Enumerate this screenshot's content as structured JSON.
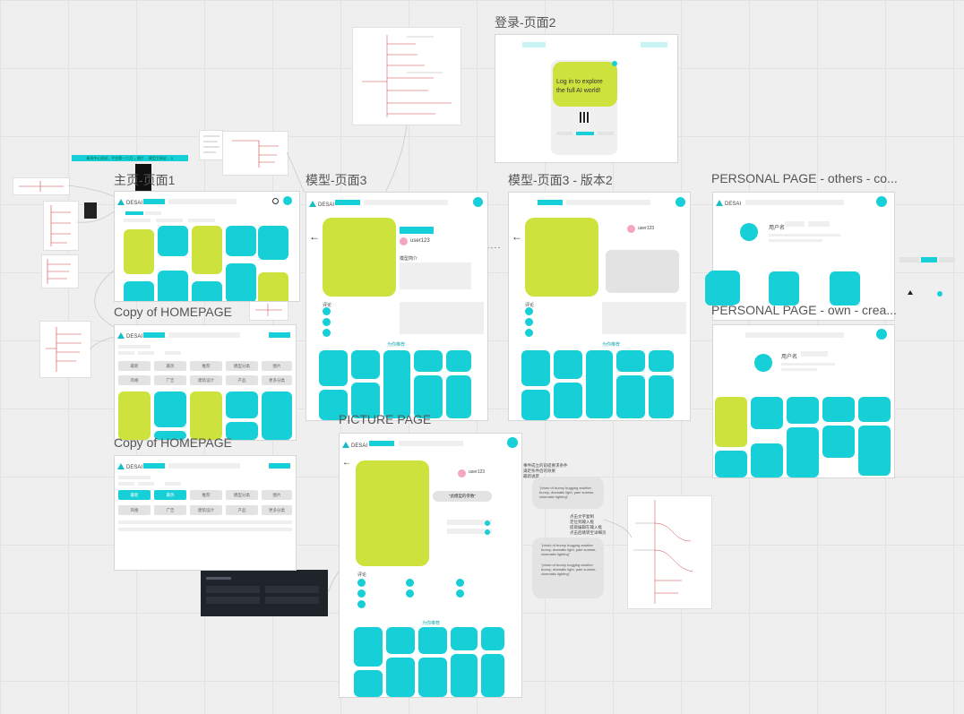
{
  "labels": {
    "home1": "主页-页面1",
    "copy1": "Copy of HOMEPAGE",
    "copy2": "Copy of HOMEPAGE",
    "model3": "模型-页面3",
    "model3v2": "模型-页面3 - 版本2",
    "login2": "登录-页面2",
    "picture": "PICTURE PAGE",
    "personal_others": "PERSONAL PAGE - others - co...",
    "personal_own": "PERSONAL PAGE - own - crea..."
  },
  "brand": "DESAI",
  "login": {
    "text": "Log in to explore the full AI world!"
  },
  "model": {
    "user": "user123",
    "section_title": "模型简介",
    "recommend": "为你推荐",
    "comments": "评论"
  },
  "personal": {
    "username": "用户名"
  },
  "picture": {
    "user": "user123",
    "prompt_btn": "\"此模型的参数\"",
    "prompt1": "\"photo of bunny hugging another bunny, dramatic light, pale sunrise, cinematic lighting\"",
    "prompt2": "\"photo of bunny hugging another bunny, dramatic light, pale sunrise, cinematic lighting\"",
    "prompt3": "\"photo of bunny hugging another bunny, dramatic light, pale sunrise, cinematic lighting\"",
    "recommend": "为你推荐",
    "comments": "评论",
    "note1": "事件成立的前提要求条件\n满足条件后的效果\n最新进度",
    "note2": "点击文字复制\n定位到输入框\n提取编辑在输入框\n点击后跳转至详细页"
  },
  "flow_banner": "新闻中心网站 - 平台第一二月 -- 图片 -- 模型主网站 -- X",
  "home_tabs": [
    "最新",
    "最热",
    "推荐",
    "模型分类",
    "图片",
    "风格",
    "广告",
    "建筑设计",
    "产品",
    "更多分类"
  ],
  "colors": {
    "accent": "#17cfd6",
    "lime": "#cde23d",
    "pink": "#f4a6c0"
  }
}
